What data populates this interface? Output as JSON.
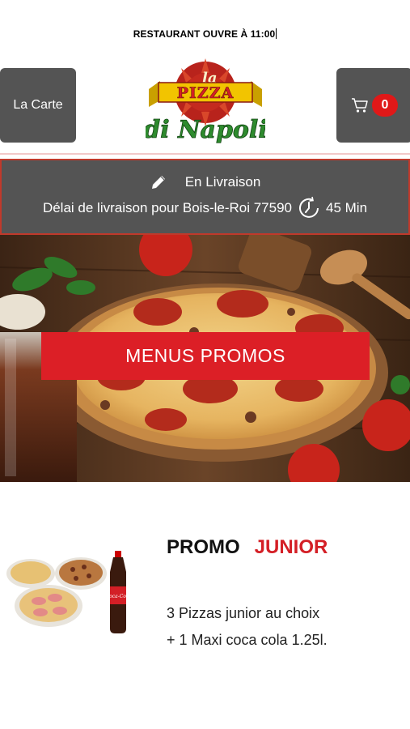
{
  "header": {
    "status_text": "RESTAURANT OUVRE À 11:00",
    "menu_button_label": "La Carte",
    "cart_count": "0",
    "logo": {
      "top_word": "la",
      "main_word": "PIZZA",
      "script_word": "di Napoli",
      "colors": {
        "red": "#d41f26",
        "green": "#2e8b2e",
        "gold": "#f2c400"
      }
    }
  },
  "delivery": {
    "mode_label": "En Livraison",
    "delay_text": "Délai de livraison pour Bois-le-Roi 77590",
    "delay_value": "45 Min",
    "icons": [
      "pencil-icon",
      "clock-icon"
    ]
  },
  "hero": {
    "button_label": "MENUS PROMOS",
    "button_color": "#dc1f26"
  },
  "promo": {
    "title_word1": "PROMO",
    "title_word2": "JUNIOR",
    "description": "3 Pizzas junior au choix  + 1 Maxi coca cola 1.25l.",
    "image_bottle_label": "Coca-Cola"
  },
  "colors": {
    "panel_grey": "#545454",
    "accent_red": "#d41f26",
    "badge_red": "#e01818"
  }
}
